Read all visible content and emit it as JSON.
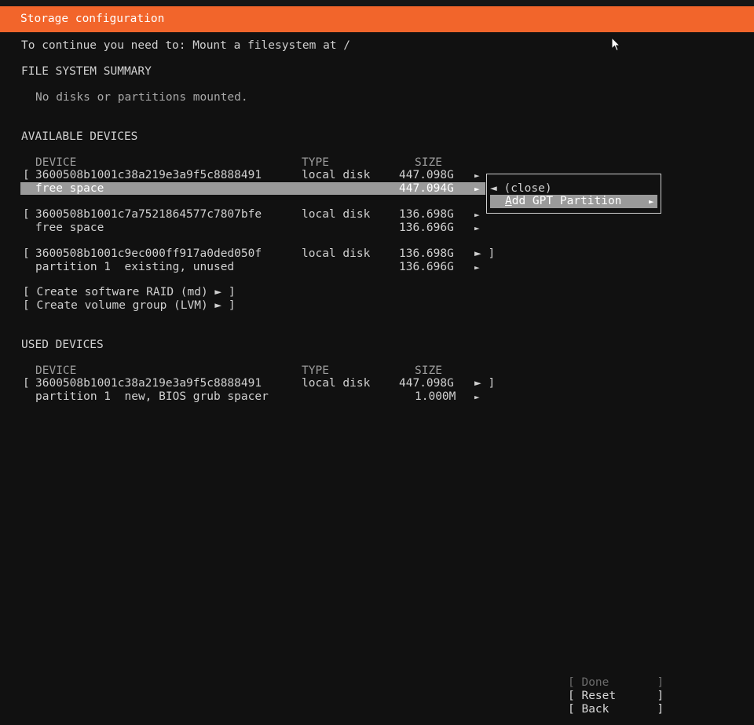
{
  "title": "Storage configuration",
  "instruction": "To continue you need to: Mount a filesystem at /",
  "fs_summary": {
    "heading": "FILE SYSTEM SUMMARY",
    "empty_text": "No disks or partitions mounted."
  },
  "available": {
    "heading": "AVAILABLE DEVICES",
    "col_device": "DEVICE",
    "col_type": "TYPE",
    "col_size": "SIZE",
    "disk1": {
      "bracket": "[",
      "name": "3600508b1001c38a219e3a9f5c8888491",
      "type": "local disk",
      "size": "447.098G",
      "arrow": "►"
    },
    "disk1_free": {
      "name": "free space",
      "size": "447.094G",
      "arrow": "►"
    },
    "disk2": {
      "bracket": "[",
      "name": "3600508b1001c7a7521864577c7807bfe",
      "type": "local disk",
      "size": "136.698G",
      "arrow": "►"
    },
    "disk2_free": {
      "name": "free space",
      "size": "136.696G",
      "arrow": "►"
    },
    "disk3": {
      "bracket": "[",
      "name": "3600508b1001c9ec000ff917a0ded050f",
      "type": "local disk",
      "size": "136.698G",
      "arrow": "► ]"
    },
    "disk3_part": {
      "name": "partition 1  existing, unused",
      "size": "136.696G",
      "arrow": "►"
    },
    "create_raid": "[ Create software RAID (md) ► ]",
    "create_lvm": "[ Create volume group (LVM) ► ]"
  },
  "context_menu": {
    "close": "◄ (close)",
    "add_first": "A",
    "add_rest": "dd GPT Partition",
    "add_arrow": "►"
  },
  "used": {
    "heading": "USED DEVICES",
    "col_device": "DEVICE",
    "col_type": "TYPE",
    "col_size": "SIZE",
    "disk1": {
      "bracket": "[",
      "name": "3600508b1001c38a219e3a9f5c8888491",
      "type": "local disk",
      "size": "447.098G",
      "arrow": "► ]"
    },
    "part1": {
      "name": "partition 1  new, BIOS grub spacer",
      "size": "1.000M",
      "arrow": "►"
    }
  },
  "buttons": {
    "done": "[ Done       ]",
    "reset": "[ Reset      ]",
    "back": "[ Back       ]"
  }
}
